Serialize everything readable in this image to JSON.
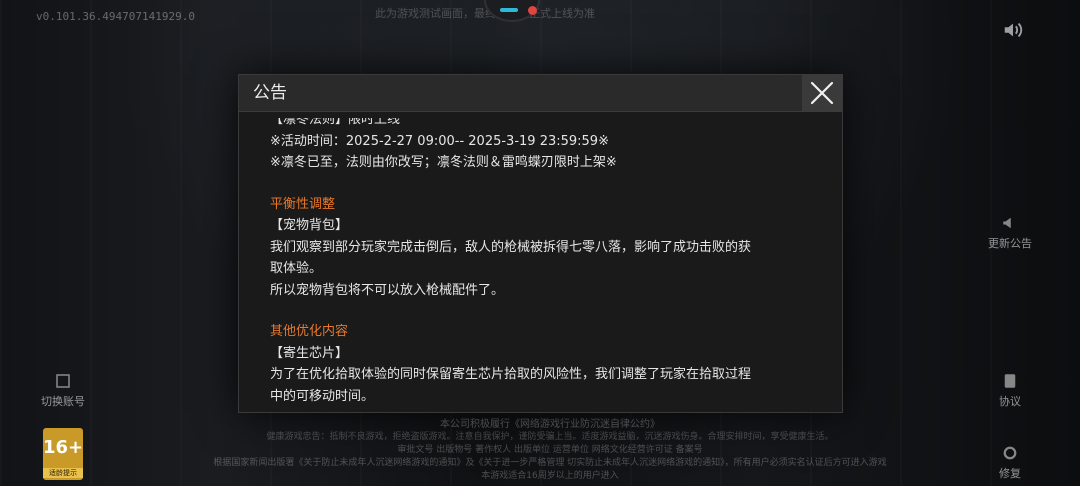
{
  "version": "v0.101.36.494707141929.0",
  "top_hint": "此为游戏测试画面，最终效果以正式上线为准",
  "side_buttons": {
    "announcement": "更新公告",
    "agreement": "协议",
    "repair": "修复",
    "switch_account": "切换账号"
  },
  "age_badge": {
    "age": "16+",
    "label": "适龄提示"
  },
  "footer": {
    "line1": "本公司积极履行《网络游戏行业防沉迷自律公约》",
    "line2": "健康游戏忠告：抵制不良游戏，拒绝盗版游戏。注意自我保护，谨防受骗上当。适度游戏益脑，沉迷游戏伤身。合理安排时间，享受健康生活。",
    "line3": "审批文号 出版物号 著作权人 出版单位 运营单位 网络文化经营许可证 备案号",
    "line4": "根据国家新闻出版署《关于防止未成年人沉迷网络游戏的通知》及《关于进一步严格管理 切实防止未成年人沉迷网络游戏的通知》，所有用户必须实名认证后方可进入游戏",
    "line5": "本游戏适合16周岁以上的用户进入"
  },
  "dialog": {
    "title": "公告",
    "close_label": "×",
    "lines": [
      {
        "type": "text",
        "text": "【凛冬法则】限时上线"
      },
      {
        "type": "text",
        "text": "※活动时间：2025-2-27 09:00-- 2025-3-19 23:59:59※"
      },
      {
        "type": "text",
        "text": "※凛冬已至，法则由你改写；凛冬法则＆雷鸣蝶刃限时上架※"
      },
      {
        "type": "gap",
        "text": ""
      },
      {
        "type": "section",
        "text": "平衡性调整"
      },
      {
        "type": "text",
        "text": "【宠物背包】"
      },
      {
        "type": "text",
        "text": "我们观察到部分玩家完成击倒后，敌人的枪械被拆得七零八落，影响了成功击败的获"
      },
      {
        "type": "text",
        "text": "取体验。"
      },
      {
        "type": "text",
        "text": "所以宠物背包将不可以放入枪械配件了。"
      },
      {
        "type": "gap",
        "text": ""
      },
      {
        "type": "section",
        "text": "其他优化内容"
      },
      {
        "type": "text",
        "text": "【寄生芯片】"
      },
      {
        "type": "text",
        "text": "为了在优化拾取体验的同时保留寄生芯片拾取的风险性，我们调整了玩家在拾取过程"
      },
      {
        "type": "text",
        "text": "中的可移动时间。"
      }
    ]
  },
  "colors": {
    "section": "#e8782a",
    "body_text": "#e6e6e6",
    "dialog_bg": "#1a1a1a",
    "header_bg": "#2a2a2a",
    "age_badge": "#c99a28"
  }
}
